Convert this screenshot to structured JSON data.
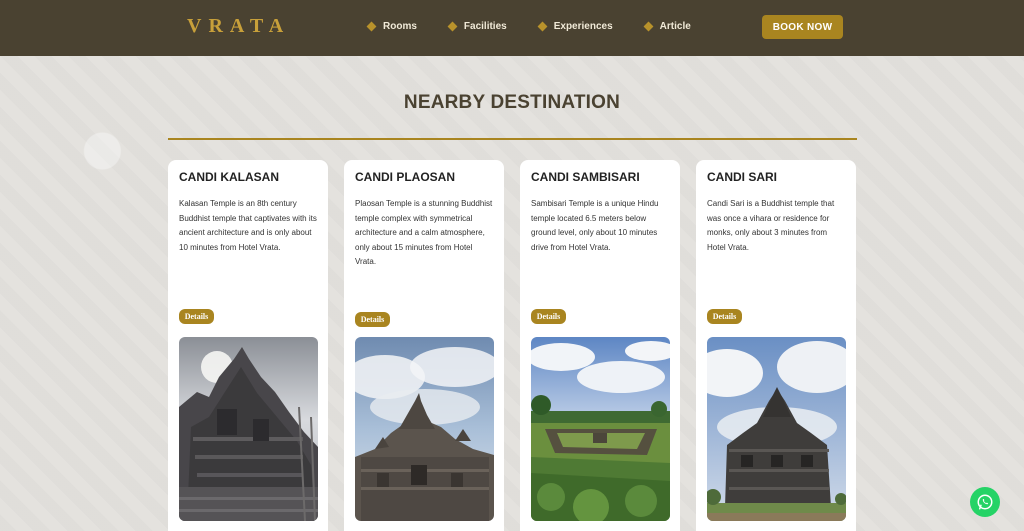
{
  "header": {
    "logo": "VRATA",
    "nav": [
      "Rooms",
      "Facilities",
      "Experiences",
      "Article"
    ],
    "book_label": "BOOK NOW"
  },
  "section": {
    "title": "NEARBY DESTINATION"
  },
  "cards": [
    {
      "title": "CANDI KALASAN",
      "description": "Kalasan Temple is an 8th century Buddhist temple that captivates with its ancient architecture and is only about 10 minutes from Hotel Vrata.",
      "details_label": "Details"
    },
    {
      "title": "CANDI PLAOSAN",
      "description": "Plaosan Temple is a stunning Buddhist temple complex with symmetrical architecture and a calm atmosphere, only about 15 minutes from Hotel Vrata.",
      "details_label": "Details"
    },
    {
      "title": "CANDI SAMBISARI",
      "description": "Sambisari Temple is a unique Hindu temple located 6.5 meters below ground level, only about 10 minutes drive from Hotel Vrata.",
      "details_label": "Details"
    },
    {
      "title": "CANDI SARI",
      "description": "Candi Sari is a Buddhist temple that was once a vihara or residence for monks, only about 3 minutes from Hotel Vrata.",
      "details_label": "Details"
    }
  ],
  "colors": {
    "header_bg": "#4a4231",
    "accent": "#a98520",
    "whatsapp": "#25d366"
  },
  "icons": {
    "nav_bullet": "diamond-icon",
    "floating": "whatsapp-icon"
  }
}
